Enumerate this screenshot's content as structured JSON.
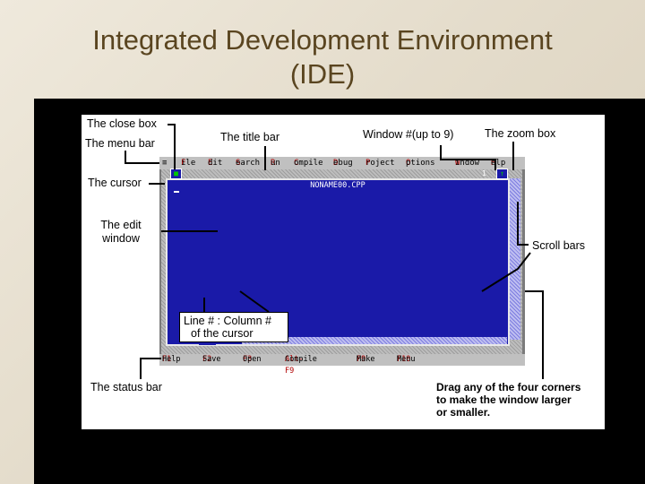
{
  "slide": {
    "title_line1": "Integrated Development Environment",
    "title_line2": "(IDE)"
  },
  "annotations": {
    "close_box": "The close box",
    "menu_bar": "The menu bar",
    "title_bar": "The title bar",
    "window_number": "Window #(up to 9)",
    "zoom_box": "The zoom box",
    "cursor": "The cursor",
    "edit_window_line1": "The edit",
    "edit_window_line2": "window",
    "scroll_bars": "Scroll bars",
    "line_col_line1": "Line # :  Column #",
    "line_col_line2": "of the cursor",
    "status_bar": "The status bar",
    "corners_line1": "Drag any of the four corners",
    "corners_line2": "to make the window larger",
    "corners_line3": "or  smaller."
  },
  "ide": {
    "menu_items": [
      {
        "hot": "",
        "rest": "≡"
      },
      {
        "hot": "F",
        "rest": "ile"
      },
      {
        "hot": "E",
        "rest": "dit"
      },
      {
        "hot": "S",
        "rest": "earch"
      },
      {
        "hot": "R",
        "rest": "un"
      },
      {
        "hot": "C",
        "rest": "ompile"
      },
      {
        "hot": "D",
        "rest": "ebug"
      },
      {
        "hot": "P",
        "rest": "roject"
      },
      {
        "hot": "O",
        "rest": "ptions"
      },
      {
        "hot": "W",
        "rest": "indow"
      },
      {
        "hot": "H",
        "rest": "elp"
      }
    ],
    "file_name": "NONAME00.CPP",
    "window_number": "1",
    "close_glyph": "■",
    "zoom_glyph": "↑",
    "line_col": "1:1",
    "status_items": [
      {
        "key": "F1",
        "label": "Help"
      },
      {
        "key": "F2",
        "label": "Save"
      },
      {
        "key": "F3",
        "label": "Open"
      },
      {
        "key": "Alt-F9",
        "label": "Compile"
      },
      {
        "key": "F9",
        "label": "Make"
      },
      {
        "key": "F10",
        "label": "Menu"
      }
    ]
  },
  "colors": {
    "edit_bg": "#1a1aa8",
    "menu_bg": "#c0c0c0",
    "title_color": "#5a4520"
  }
}
